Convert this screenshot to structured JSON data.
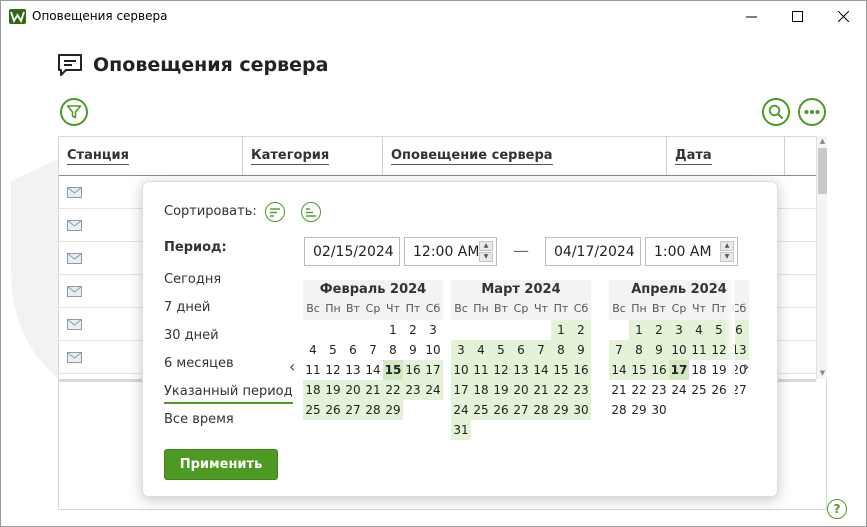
{
  "window": {
    "title": "Оповещения сервера"
  },
  "page": {
    "title": "Оповещения сервера"
  },
  "table": {
    "columns": [
      "Станция",
      "Категория",
      "Оповещение сервера",
      "Дата"
    ],
    "row_count": 6
  },
  "popup": {
    "sort_label": "Сортировать:",
    "period_label": "Период:",
    "periods": [
      "Сегодня",
      "7 дней",
      "30 дней",
      "6 месяцев",
      "Указанный период",
      "Все время"
    ],
    "active_period": "Указанный период",
    "start_date": "02/15/2024",
    "start_time": "12:00 AM",
    "end_date": "04/17/2024",
    "end_time": "1:00 AM",
    "range_separator": "—",
    "apply_label": "Применить",
    "weekdays": [
      "Вс",
      "Пн",
      "Вт",
      "Ср",
      "Чт",
      "Пт",
      "Сб"
    ],
    "months": [
      {
        "title": "Февраль 2024",
        "first_dow": 4,
        "days": 29,
        "range": [
          15,
          29
        ],
        "mark": [
          15
        ]
      },
      {
        "title": "Март 2024",
        "first_dow": 5,
        "days": 31,
        "range": [
          1,
          31
        ],
        "mark": []
      },
      {
        "title": "Апрель 2024",
        "first_dow": 1,
        "days": 30,
        "range": [
          1,
          17
        ],
        "mark": [
          17
        ]
      }
    ]
  },
  "colors": {
    "accent": "#4c9a22",
    "range_fill": "#e4f2d8"
  },
  "help_label": "?"
}
